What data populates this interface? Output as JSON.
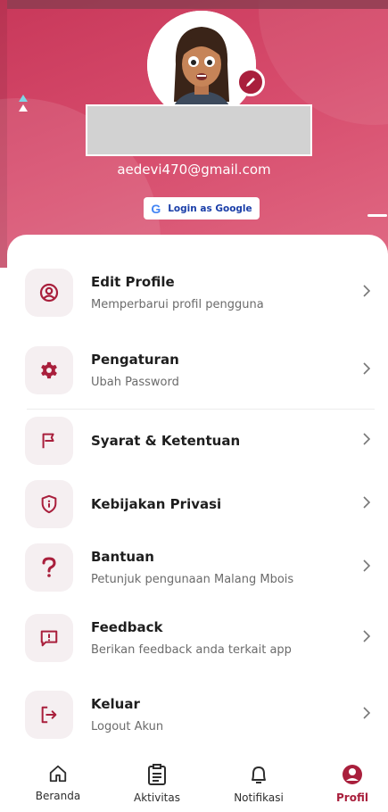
{
  "profile": {
    "email": "aedevi470@gmail.com",
    "login_button": "Login as Google",
    "google_letter": "G"
  },
  "menu": [
    {
      "title": "Edit Profile",
      "subtitle": "Memperbarui profil pengguna",
      "icon": "user-circle-icon"
    },
    {
      "title": "Pengaturan",
      "subtitle": "Ubah Password",
      "icon": "gear-icon"
    },
    {
      "title": "Syarat & Ketentuan",
      "subtitle": "",
      "icon": "flag-icon"
    },
    {
      "title": "Kebijakan Privasi",
      "subtitle": "",
      "icon": "shield-info-icon"
    },
    {
      "title": "Bantuan",
      "subtitle": "Petunjuk pengunaan Malang Mbois",
      "icon": "question-icon"
    },
    {
      "title": "Feedback",
      "subtitle": "Berikan feedback anda terkait app",
      "icon": "feedback-icon"
    },
    {
      "title": "Keluar",
      "subtitle": "Logout Akun",
      "icon": "logout-icon"
    }
  ],
  "nav": [
    {
      "label": "Beranda",
      "icon": "home-icon"
    },
    {
      "label": "Aktivitas",
      "icon": "clipboard-icon"
    },
    {
      "label": "Notifikasi",
      "icon": "bell-icon"
    },
    {
      "label": "Profil",
      "icon": "profile-icon",
      "active": true
    }
  ],
  "colors": {
    "accent": "#a91f3c",
    "header": "#d64a6b"
  }
}
